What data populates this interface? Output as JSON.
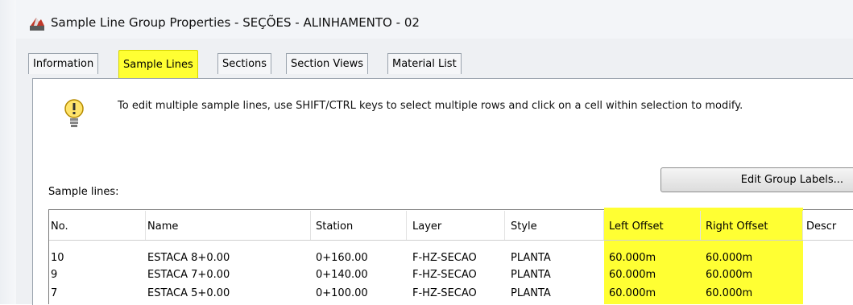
{
  "window": {
    "title": "Sample Line Group Properties - SEÇÕES - ALINHAMENTO - 02",
    "app_icon": "civil3d-app-icon"
  },
  "tabs": [
    {
      "label": "Information",
      "active": false
    },
    {
      "label": "Sample Lines",
      "active": true
    },
    {
      "label": "Sections",
      "active": false
    },
    {
      "label": "Section Views",
      "active": false
    },
    {
      "label": "Material List",
      "active": false
    }
  ],
  "info": {
    "icon": "exclamation-bulb-icon",
    "message": "To edit multiple sample lines, use SHIFT/CTRL keys to select multiple rows and click on a cell within selection to modify."
  },
  "edit_group_labels_button": "Edit Group Labels...",
  "sample_lines_label": "Sample lines:",
  "table": {
    "columns": [
      "No.",
      "Name",
      "Station",
      "Layer",
      "Style",
      "Left Offset",
      "Right Offset",
      "Descr"
    ],
    "rows": [
      [
        "10",
        "ESTACA 8+0.00",
        "0+160.00",
        "F-HZ-SECAO",
        "PLANTA",
        "60.000m",
        "60.000m",
        ""
      ],
      [
        "9",
        "ESTACA 7+0.00",
        "0+140.00",
        "F-HZ-SECAO",
        "PLANTA",
        "60.000m",
        "60.000m",
        ""
      ],
      [
        "7",
        "ESTACA 5+0.00",
        "0+100.00",
        "F-HZ-SECAO",
        "PLANTA",
        "60.000m",
        "60.000m",
        ""
      ]
    ]
  },
  "colors": {
    "highlight": "#ffff33",
    "panel": "#eef0f3"
  }
}
